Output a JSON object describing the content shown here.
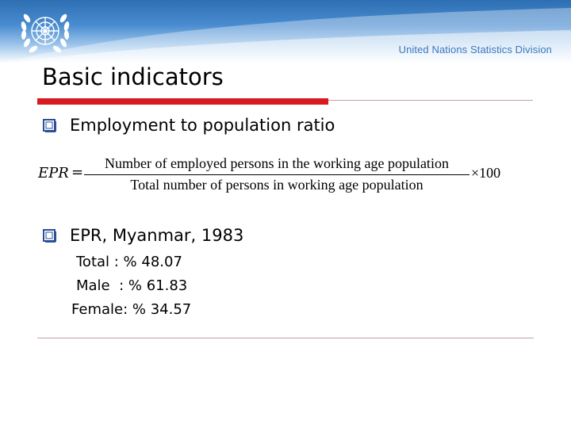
{
  "header": {
    "logo": "un-emblem-icon",
    "division": "United Nations Statistics Division"
  },
  "title": "Basic indicators",
  "bullets": [
    {
      "icon": "checkbox-bullet-icon",
      "text": "Employment to population ratio"
    },
    {
      "icon": "checkbox-bullet-icon",
      "text": "EPR, Myanmar, 1983"
    }
  ],
  "formula": {
    "lhs": "EPR",
    "equals": "=",
    "numerator": "Number of employed persons in the working age population",
    "denominator": "Total number of persons in working age population",
    "multiplier": "×100"
  },
  "stats": [
    {
      "label": "Total : % 48.07"
    },
    {
      "label": "Male  : % 61.83"
    },
    {
      "label": "Female: % 34.57"
    }
  ],
  "colors": {
    "header_blue": "#2e6fb4",
    "division_text": "#3b78bf",
    "title_rule_red": "#d81a21",
    "bullet_blue": "#2a4f9a"
  }
}
